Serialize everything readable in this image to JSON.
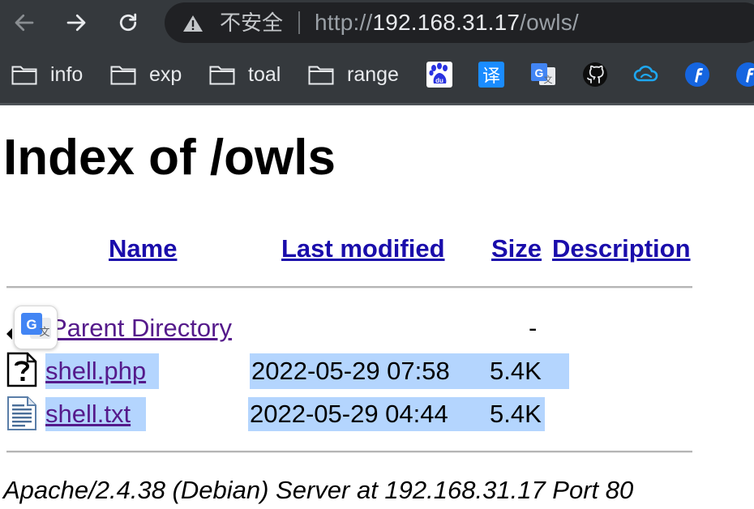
{
  "browser": {
    "url_scheme": "http://",
    "url_host": "192.168.31.17",
    "url_path": "/owls/",
    "security_label": "不安全",
    "bookmarks": [
      {
        "label": "info"
      },
      {
        "label": "exp"
      },
      {
        "label": "toal"
      },
      {
        "label": "range"
      }
    ],
    "bookmark_icons": [
      "baidu-icon",
      "translate-icon",
      "google-translate-icon",
      "github-icon",
      "cloud-icon",
      "flash-icon",
      "flash-icon"
    ],
    "icon_label_baidu": "du",
    "icon_label_translate": "译"
  },
  "page": {
    "title": "Index of /owls",
    "columns": {
      "name": "Name",
      "last_modified": "Last modified",
      "size": "Size",
      "description": "Description"
    },
    "parent": {
      "name": "Parent Directory",
      "size": "-"
    },
    "files": [
      {
        "name": "shell.php",
        "modified": "2022-05-29 07:58",
        "size": "5.4K",
        "icon": "unknown-file-icon"
      },
      {
        "name": "shell.txt",
        "modified": "2022-05-29 04:44",
        "size": "5.4K",
        "icon": "text-file-icon"
      }
    ],
    "footer": "Apache/2.4.38 (Debian) Server at 192.168.31.17 Port 80"
  },
  "colors": {
    "chrome_bg": "#35393d",
    "omnibox_bg": "#202124",
    "visited_link": "#551a8b",
    "header_link": "#1a0dab",
    "selection": "#b4d5fe"
  }
}
